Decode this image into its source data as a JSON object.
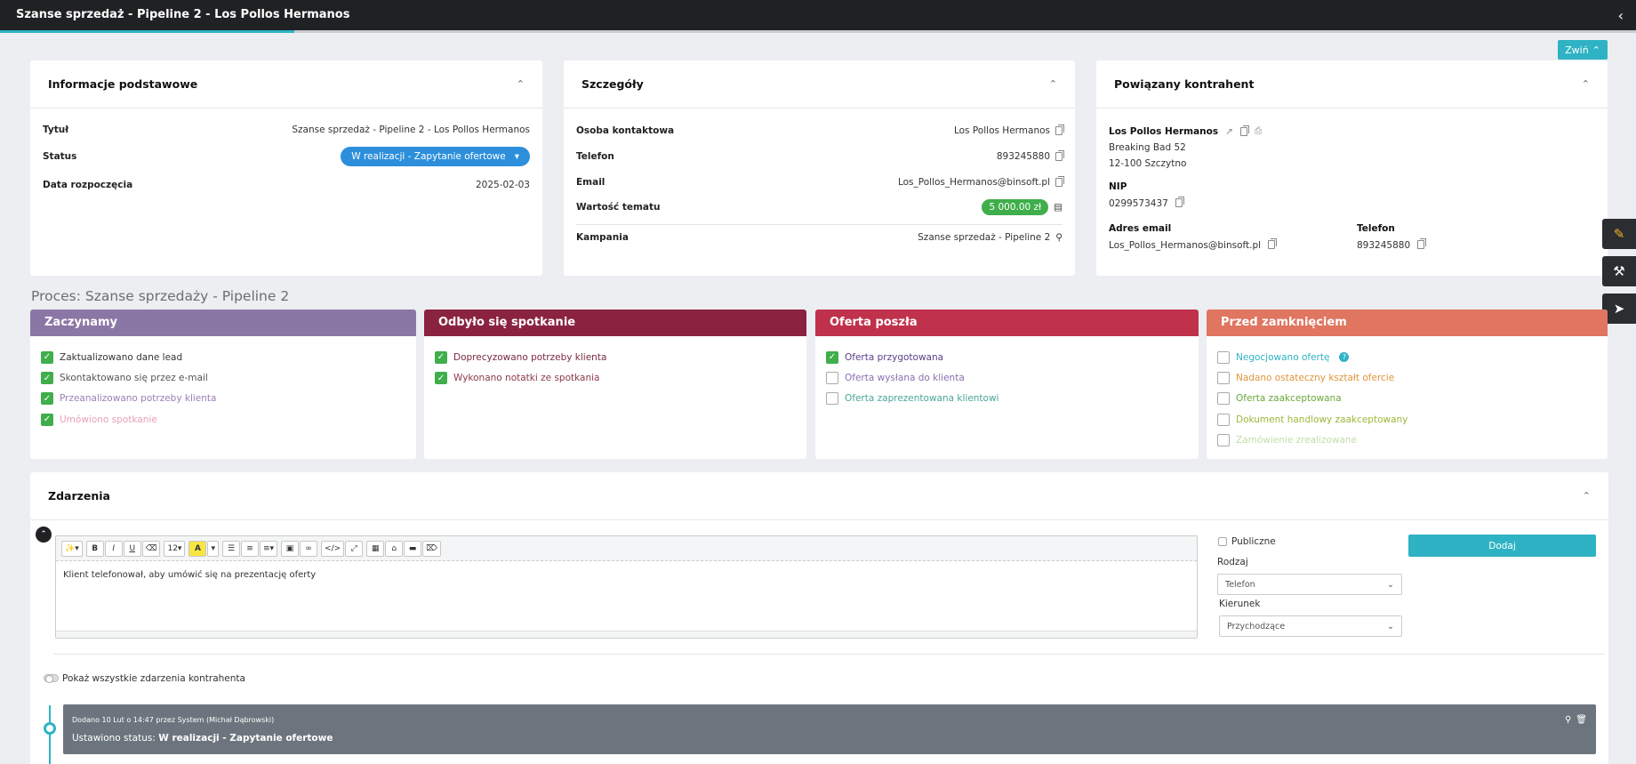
{
  "header": {
    "title": "Szanse sprzedaż - Pipeline 2 - Los Pollos Hermanos",
    "collapse_label": "Zwiń",
    "progress_fraction": 0.18
  },
  "basic": {
    "title": "Informacje podstawowe",
    "tytul_label": "Tytuł",
    "tytul_value": "Szanse sprzedaż - Pipeline 2 - Los Pollos Hermanos",
    "status_label": "Status",
    "status_value": "W realizacji - Zapytanie ofertowe",
    "date_label": "Data rozpoczęcia",
    "date_value": "2025-02-03"
  },
  "details": {
    "title": "Szczegóły",
    "contact_label": "Osoba kontaktowa",
    "contact_value": "Los Pollos Hermanos",
    "phone_label": "Telefon",
    "phone_value": "893245880",
    "email_label": "Email",
    "email_value": "Los_Pollos_Hermanos@binsoft.pl",
    "value_label": "Wartość tematu",
    "value_value": "5 000.00 zł",
    "campaign_label": "Kampania",
    "campaign_value": "Szanse sprzedaż - Pipeline 2"
  },
  "contractor": {
    "title": "Powiązany kontrahent",
    "name": "Los Pollos Hermanos",
    "street": "Breaking Bad 52",
    "city": "12-100 Szczytno",
    "nip_label": "NIP",
    "nip_value": "0299573437",
    "email_label": "Adres email",
    "email_value": "Los_Pollos_Hermanos@binsoft.pl",
    "phone_label": "Telefon",
    "phone_value": "893245880"
  },
  "process": {
    "title": "Proces: Szanse sprzedaży - Pipeline 2",
    "stages": [
      {
        "name": "Zaczynamy",
        "color": "#8b77a6",
        "items": [
          {
            "label": "Zaktualizowano dane lead",
            "checked": true,
            "color": "#333333"
          },
          {
            "label": "Skontaktowano się przez e-mail",
            "checked": true,
            "color": "#555555"
          },
          {
            "label": "Przeanalizowano potrzeby klienta",
            "checked": true,
            "color": "#9b7fb6"
          },
          {
            "label": "Umówiono spotkanie",
            "checked": true,
            "color": "#e8a0b4"
          }
        ]
      },
      {
        "name": "Odbyło się spotkanie",
        "color": "#8a2340",
        "items": [
          {
            "label": "Doprecyzowano potrzeby klienta",
            "checked": true,
            "color": "#7a2a3f"
          },
          {
            "label": "Wykonano notatki ze spotkania",
            "checked": true,
            "color": "#8a3a4a"
          }
        ]
      },
      {
        "name": "Oferta poszła",
        "color": "#c0314c",
        "items": [
          {
            "label": "Oferta przygotowana",
            "checked": true,
            "color": "#5a3f8a"
          },
          {
            "label": "Oferta wysłana do klienta",
            "checked": false,
            "color": "#8a6fb0"
          },
          {
            "label": "Oferta zaprezentowana klientowi",
            "checked": false,
            "color": "#4aa69b"
          }
        ]
      },
      {
        "name": "Przed zamknięciem",
        "color": "#e07560",
        "items": [
          {
            "label": "Negocjowano ofertę",
            "checked": false,
            "color": "#2eb3c4",
            "help": "?"
          },
          {
            "label": "Nadano ostateczny kształt ofercie",
            "checked": false,
            "color": "#e0953a"
          },
          {
            "label": "Oferta zaakceptowana",
            "checked": false,
            "color": "#6aa83a"
          },
          {
            "label": "Dokument handlowy zaakceptowany",
            "checked": false,
            "color": "#9ab83a"
          },
          {
            "label": "Zamówienie zrealizowane",
            "checked": false,
            "color": "#c5dcaa"
          }
        ]
      }
    ]
  },
  "events": {
    "title": "Zdarzenia",
    "editor_text": "Klient telefonował, aby umówić się na prezentację oferty",
    "toolbar_font_size": "12",
    "public_label": "Publiczne",
    "type_label": "Rodzaj",
    "type_value": "Telefon",
    "direction_label": "Kierunek",
    "direction_value": "Przychodzące",
    "add_label": "Dodaj",
    "show_all_label": "Pokaż wszystkie zdarzenia kontrahenta",
    "entry": {
      "meta": "Dodano 10 Lut o 14:47 przez System (Michał Dąbrowski)",
      "prefix": "Ustawiono status: ",
      "status": "W realizacji - Zapytanie ofertowe"
    }
  }
}
